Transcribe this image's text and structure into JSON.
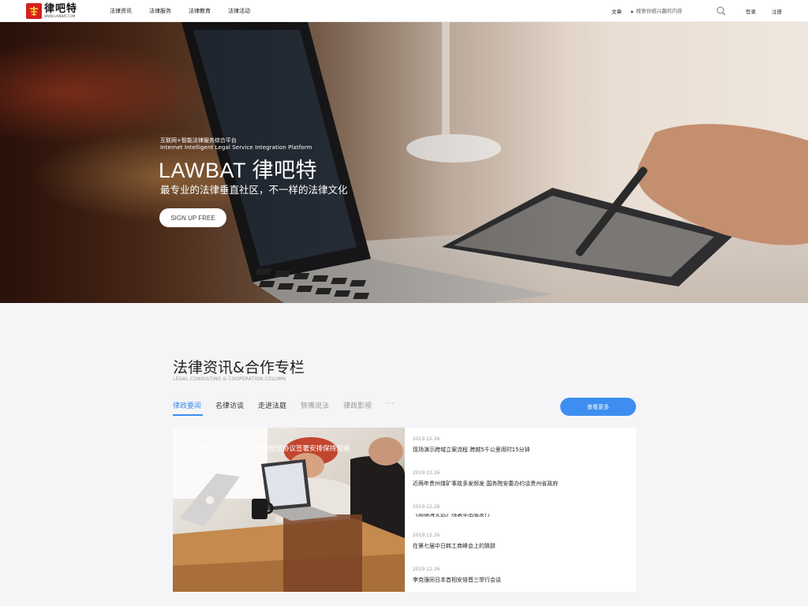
{
  "header": {
    "logo": {
      "text": "律吧特",
      "url": "WWW.LAWBAT.COM"
    },
    "nav": [
      "法律资讯",
      "法律服务",
      "法律教育",
      "法律活动"
    ],
    "search": {
      "type_label": "文章",
      "placeholder": "搜索你感兴趣的内容"
    },
    "login": "登录",
    "register": "注册"
  },
  "hero": {
    "subtitle_cn": "互联网+智能法律服务综合平台",
    "subtitle_en": "Internet Intelligent Legal Service Integration Platform",
    "title": "LAWBAT 律吧特",
    "slogan": "最专业的法律垂直社区，不一样的法律文化",
    "cta": "SIGN UP FREE"
  },
  "section": {
    "title": "法律资讯&合作专栏",
    "subtitle": "LEGAL CONSULTING & COOPERATION COLUMN",
    "tabs": [
      "律政要闻",
      "名律访谈",
      "走进法庭",
      "铁嘴说法",
      "律政影视"
    ],
    "more_tabs": "···",
    "more_button": "查看更多",
    "feature_caption": "马克思：中国工局于一阶段经贸协议签署安排保持沟通",
    "news": [
      {
        "date": "2019.12.26",
        "title": "现场演示跨域立案流程 跨越5千公里用时15分钟"
      },
      {
        "date": "2019.12.26",
        "title": "近两年贵州煤矿事故多发频发 国务院安委办约谈贵州省政府"
      },
      {
        "date": "2019.12.26",
        "title": "《胡锦涛文选》线装本出版发行"
      },
      {
        "date": "2019.12.26",
        "title": "在第七届中日韩工商峰会上的致辞"
      },
      {
        "date": "2019.12.26",
        "title": "李克强同日本首相安倍晋三举行会谈"
      }
    ]
  }
}
